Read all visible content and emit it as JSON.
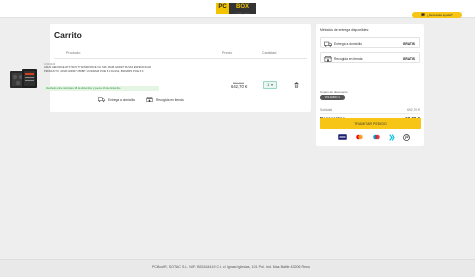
{
  "header": {
    "logo_left": "PC",
    "logo_right": "BOX",
    "logo_tagline": "quality store"
  },
  "cart": {
    "title": "Carrito",
    "columns": {
      "product": "Producto",
      "price": "Precio",
      "quantity": "Cantidad"
    },
    "item": {
      "ref": "C:001423",
      "name": "ASUS GEFORCE RTX 5070 TI WINDFORCE OC SFF 16GB GDDR7 DLSS4 ESPECIFICAR PRODUCTO, 16GB GDDR7 256BIT 17240MHZ PCIE 5.0 DLSS4, 896GBPS PCIE 5.0",
      "delivery_note": "Recíbelo entre miércoles 18 de diciembre y jueves 19 de diciembre",
      "shipping_options": [
        "Entrega a domicilio",
        "Recogida en tienda"
      ],
      "old_price": "692,70 €",
      "price": "642,70 €",
      "quantity": "1",
      "quantity_caret": "▾"
    }
  },
  "summary": {
    "heading": "Métodos de entrega disponibles:",
    "delivery_methods": [
      {
        "label": "Entrega a domicilio",
        "price": "GRATIS",
        "icon": "truck-icon"
      },
      {
        "label": "Recogida en tienda",
        "price": "GRATIS",
        "icon": "store-icon"
      }
    ],
    "coupon_label": "Cupón de descuento",
    "coupon_code": "VOLANDO ✕",
    "subtotal_label": "Subtotal",
    "subtotal_value": "692,70 €",
    "discounts_label": "Descuentos",
    "discounts_value": "-50,00 €",
    "total_label": "Total",
    "total_tax": "(impuestos incluidos)",
    "total_value": "642,70 €",
    "order_button": "TRAMITAR PEDIDO",
    "payment_methods": [
      "visa-icon",
      "mastercard-icon",
      "maestro-icon",
      "bizum-icon",
      "paypal-icon"
    ]
  },
  "footer": {
    "text": "PCBoxIR, SOTAC S.L. NIF: B53164419 C.I. c/ Ignasi Iglesias, 101 Pol. Ind. Mas Batlle 43206 Reus",
    "help_button": "¿Necesitas ayuda?"
  },
  "colors": {
    "accent": "#f6c515",
    "background": "#eeeeee",
    "badge_green": "#2e8b3e"
  }
}
